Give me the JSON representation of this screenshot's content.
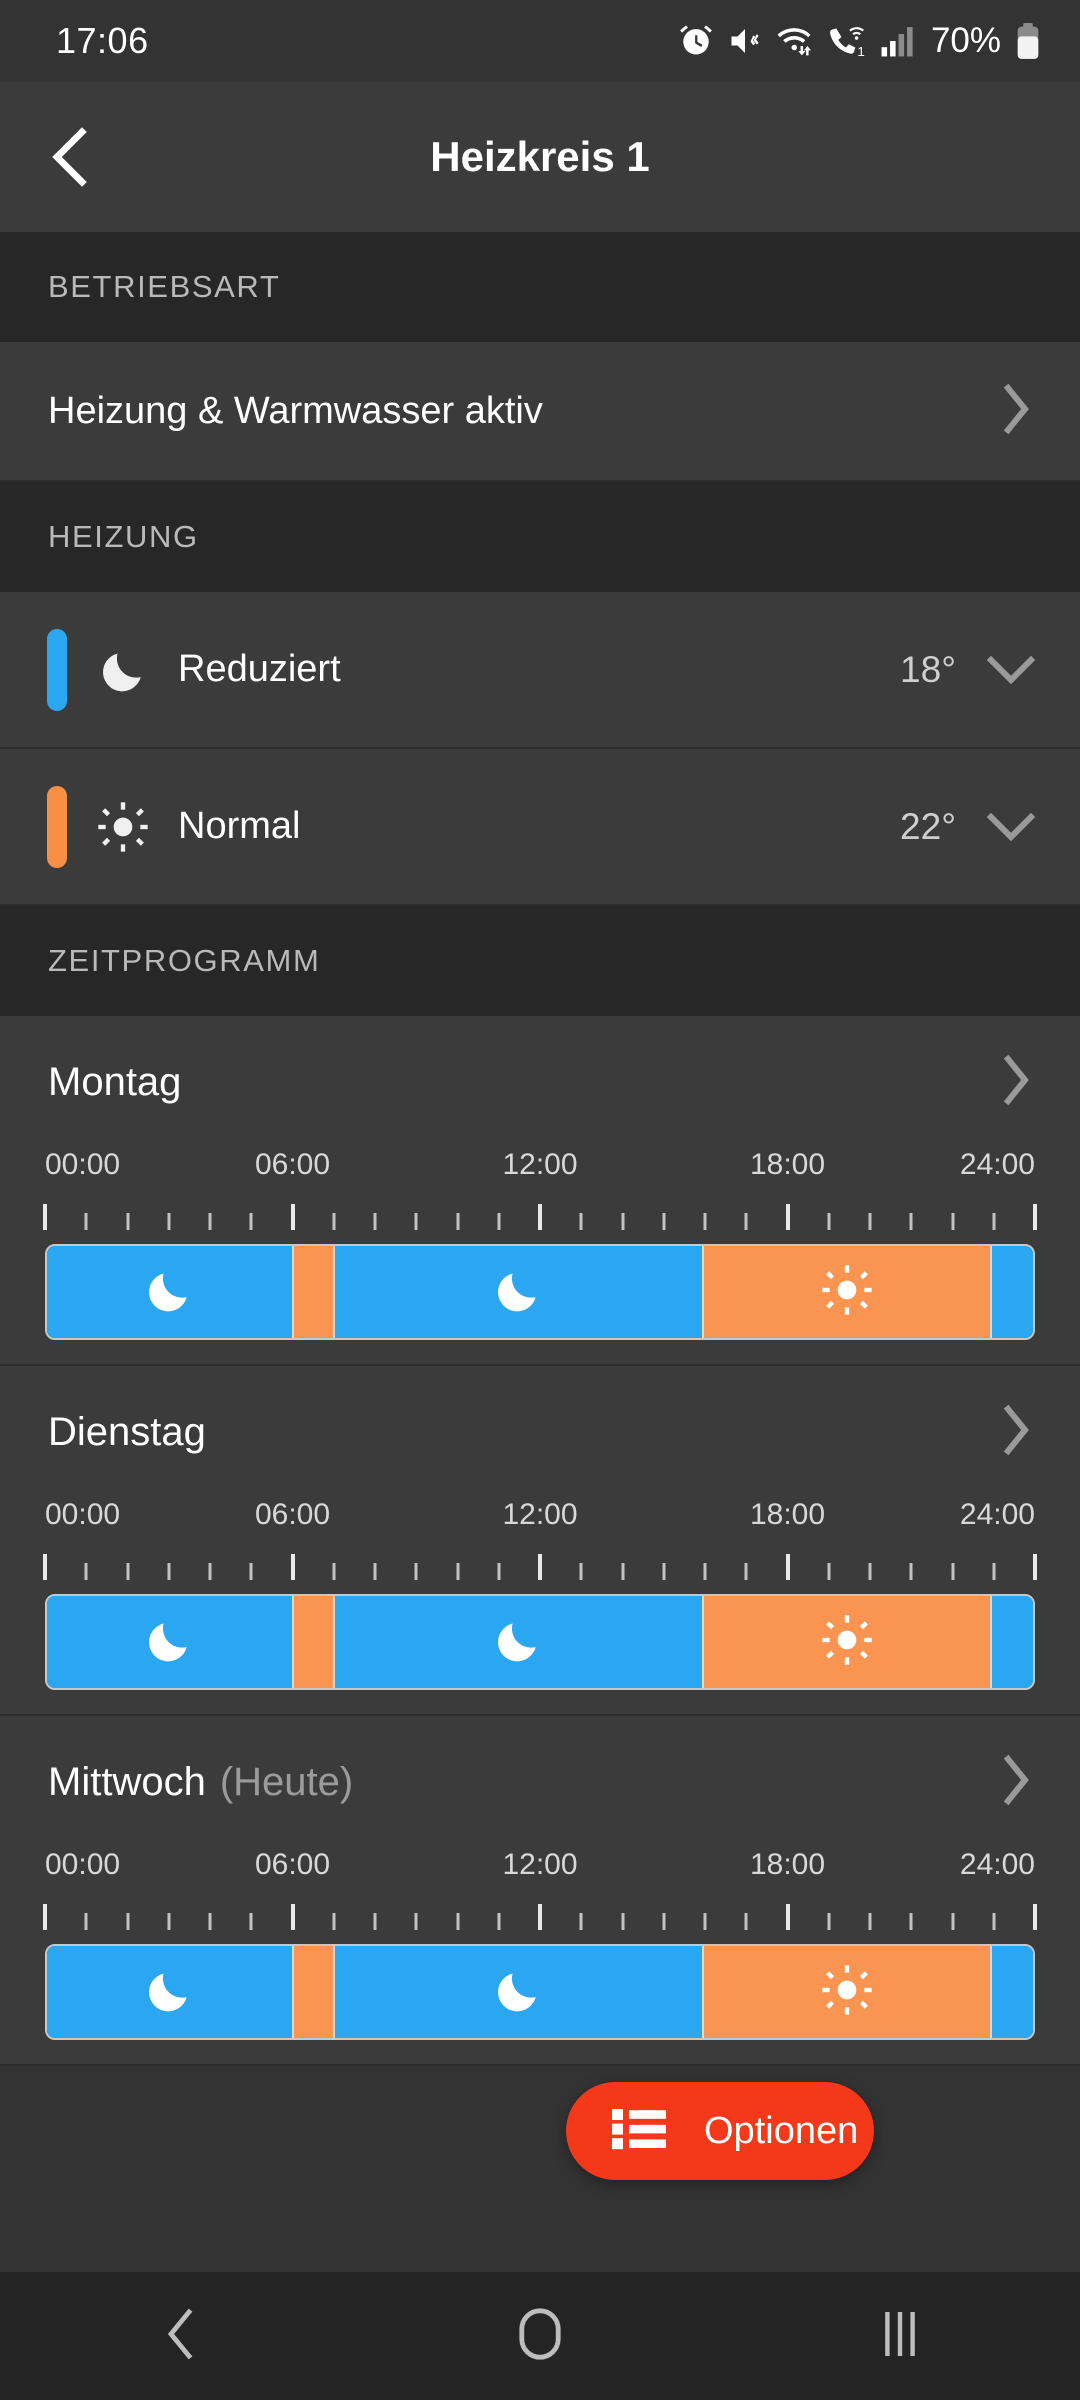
{
  "status_bar": {
    "time": "17:06",
    "battery_percent": "70%",
    "icons": [
      "alarm-icon",
      "mute-vibrate-icon",
      "wifi-icon",
      "wifi-calling-icon",
      "signal-bars-icon",
      "battery-icon"
    ]
  },
  "app_bar": {
    "title": "Heizkreis 1",
    "back_icon": "chevron-left-icon"
  },
  "sections": {
    "betriebsart": {
      "header": "BETRIEBSART",
      "row_label": "Heizung & Warmwasser aktiv",
      "chevron_icon": "chevron-right-icon"
    },
    "heizung": {
      "header": "HEIZUNG",
      "modes": [
        {
          "label": "Reduziert",
          "value": "18°",
          "icon": "moon-icon",
          "color": "#2BA7F2",
          "caret_icon": "chevron-down-icon"
        },
        {
          "label": "Normal",
          "value": "22°",
          "icon": "sun-icon",
          "color": "#F79044",
          "caret_icon": "chevron-down-icon"
        }
      ]
    },
    "zeitprogramm": {
      "header": "ZEITPROGRAMM",
      "axis_labels": [
        "00:00",
        "06:00",
        "12:00",
        "18:00",
        "24:00"
      ],
      "colors": {
        "reduced": "#2BA7F2",
        "normal": "#F99550"
      },
      "days": [
        {
          "name": "Montag",
          "today_suffix": "",
          "chevron_icon": "chevron-right-icon",
          "segments": [
            {
              "start": 0,
              "end": 6,
              "mode": "reduced",
              "icon": "moon-icon"
            },
            {
              "start": 6,
              "end": 7,
              "mode": "normal",
              "icon": ""
            },
            {
              "start": 7,
              "end": 16,
              "mode": "reduced",
              "icon": "moon-icon"
            },
            {
              "start": 16,
              "end": 23,
              "mode": "normal",
              "icon": "sun-icon"
            },
            {
              "start": 23,
              "end": 24,
              "mode": "reduced",
              "icon": ""
            }
          ]
        },
        {
          "name": "Dienstag",
          "today_suffix": "",
          "chevron_icon": "chevron-right-icon",
          "segments": [
            {
              "start": 0,
              "end": 6,
              "mode": "reduced",
              "icon": "moon-icon"
            },
            {
              "start": 6,
              "end": 7,
              "mode": "normal",
              "icon": ""
            },
            {
              "start": 7,
              "end": 16,
              "mode": "reduced",
              "icon": "moon-icon"
            },
            {
              "start": 16,
              "end": 23,
              "mode": "normal",
              "icon": "sun-icon"
            },
            {
              "start": 23,
              "end": 24,
              "mode": "reduced",
              "icon": ""
            }
          ]
        },
        {
          "name": "Mittwoch",
          "today_suffix": "(Heute)",
          "chevron_icon": "chevron-right-icon",
          "segments": [
            {
              "start": 0,
              "end": 6,
              "mode": "reduced",
              "icon": "moon-icon"
            },
            {
              "start": 6,
              "end": 7,
              "mode": "normal",
              "icon": ""
            },
            {
              "start": 7,
              "end": 16,
              "mode": "reduced",
              "icon": "moon-icon"
            },
            {
              "start": 16,
              "end": 23,
              "mode": "normal",
              "icon": "sun-icon"
            },
            {
              "start": 23,
              "end": 24,
              "mode": "reduced",
              "icon": ""
            }
          ]
        }
      ]
    }
  },
  "fab": {
    "label": "Optionen",
    "icon": "list-icon",
    "color": "#F4381A"
  },
  "nav_bar": {
    "back_icon": "nav-back-icon",
    "home_icon": "nav-home-icon",
    "recents_icon": "nav-recents-icon"
  }
}
